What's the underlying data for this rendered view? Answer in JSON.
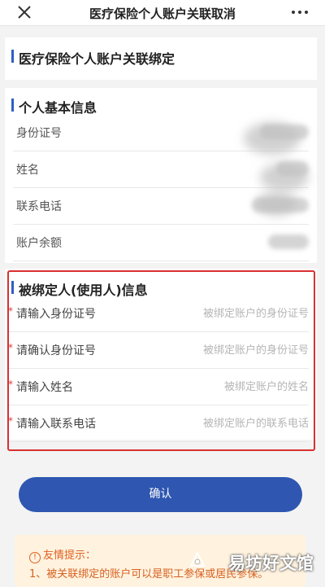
{
  "topbar": {
    "title": "医疗保险个人账户关联取消",
    "close_icon": "close-icon",
    "more_icon": "more-icon"
  },
  "header_card": {
    "title": "医疗保险个人账户关联绑定"
  },
  "personal_info": {
    "title": "个人基本信息",
    "rows": [
      {
        "label": "身份证号"
      },
      {
        "label": "姓名"
      },
      {
        "label": "联系电话"
      },
      {
        "label": "账户余额"
      }
    ]
  },
  "binding_info": {
    "title": "被绑定人(使用人)信息",
    "required_mark": "*",
    "fields": [
      {
        "label": "请输入身份证号",
        "placeholder": "被绑定账户的身份证号",
        "value": ""
      },
      {
        "label": "请确认身份证号",
        "placeholder": "被绑定账户的身份证号",
        "value": ""
      },
      {
        "label": "请输入姓名",
        "placeholder": "被绑定账户的姓名",
        "value": ""
      },
      {
        "label": "请输入联系电话",
        "placeholder": "被绑定账户的联系电话",
        "value": ""
      }
    ]
  },
  "confirm": {
    "label": "确认",
    "color": "#2f56b0"
  },
  "tips": {
    "title": "友情提示：",
    "icon": "info-icon",
    "line1": "1、被关联绑定的账户可以是职工参保或居民参保。"
  },
  "watermark": {
    "text": "易坊好文馆"
  },
  "colors": {
    "accent": "#2f5fc4",
    "highlight": "#d93030",
    "required": "#e04040",
    "tip_text": "#d86020",
    "tip_bg": "#fff3df"
  }
}
